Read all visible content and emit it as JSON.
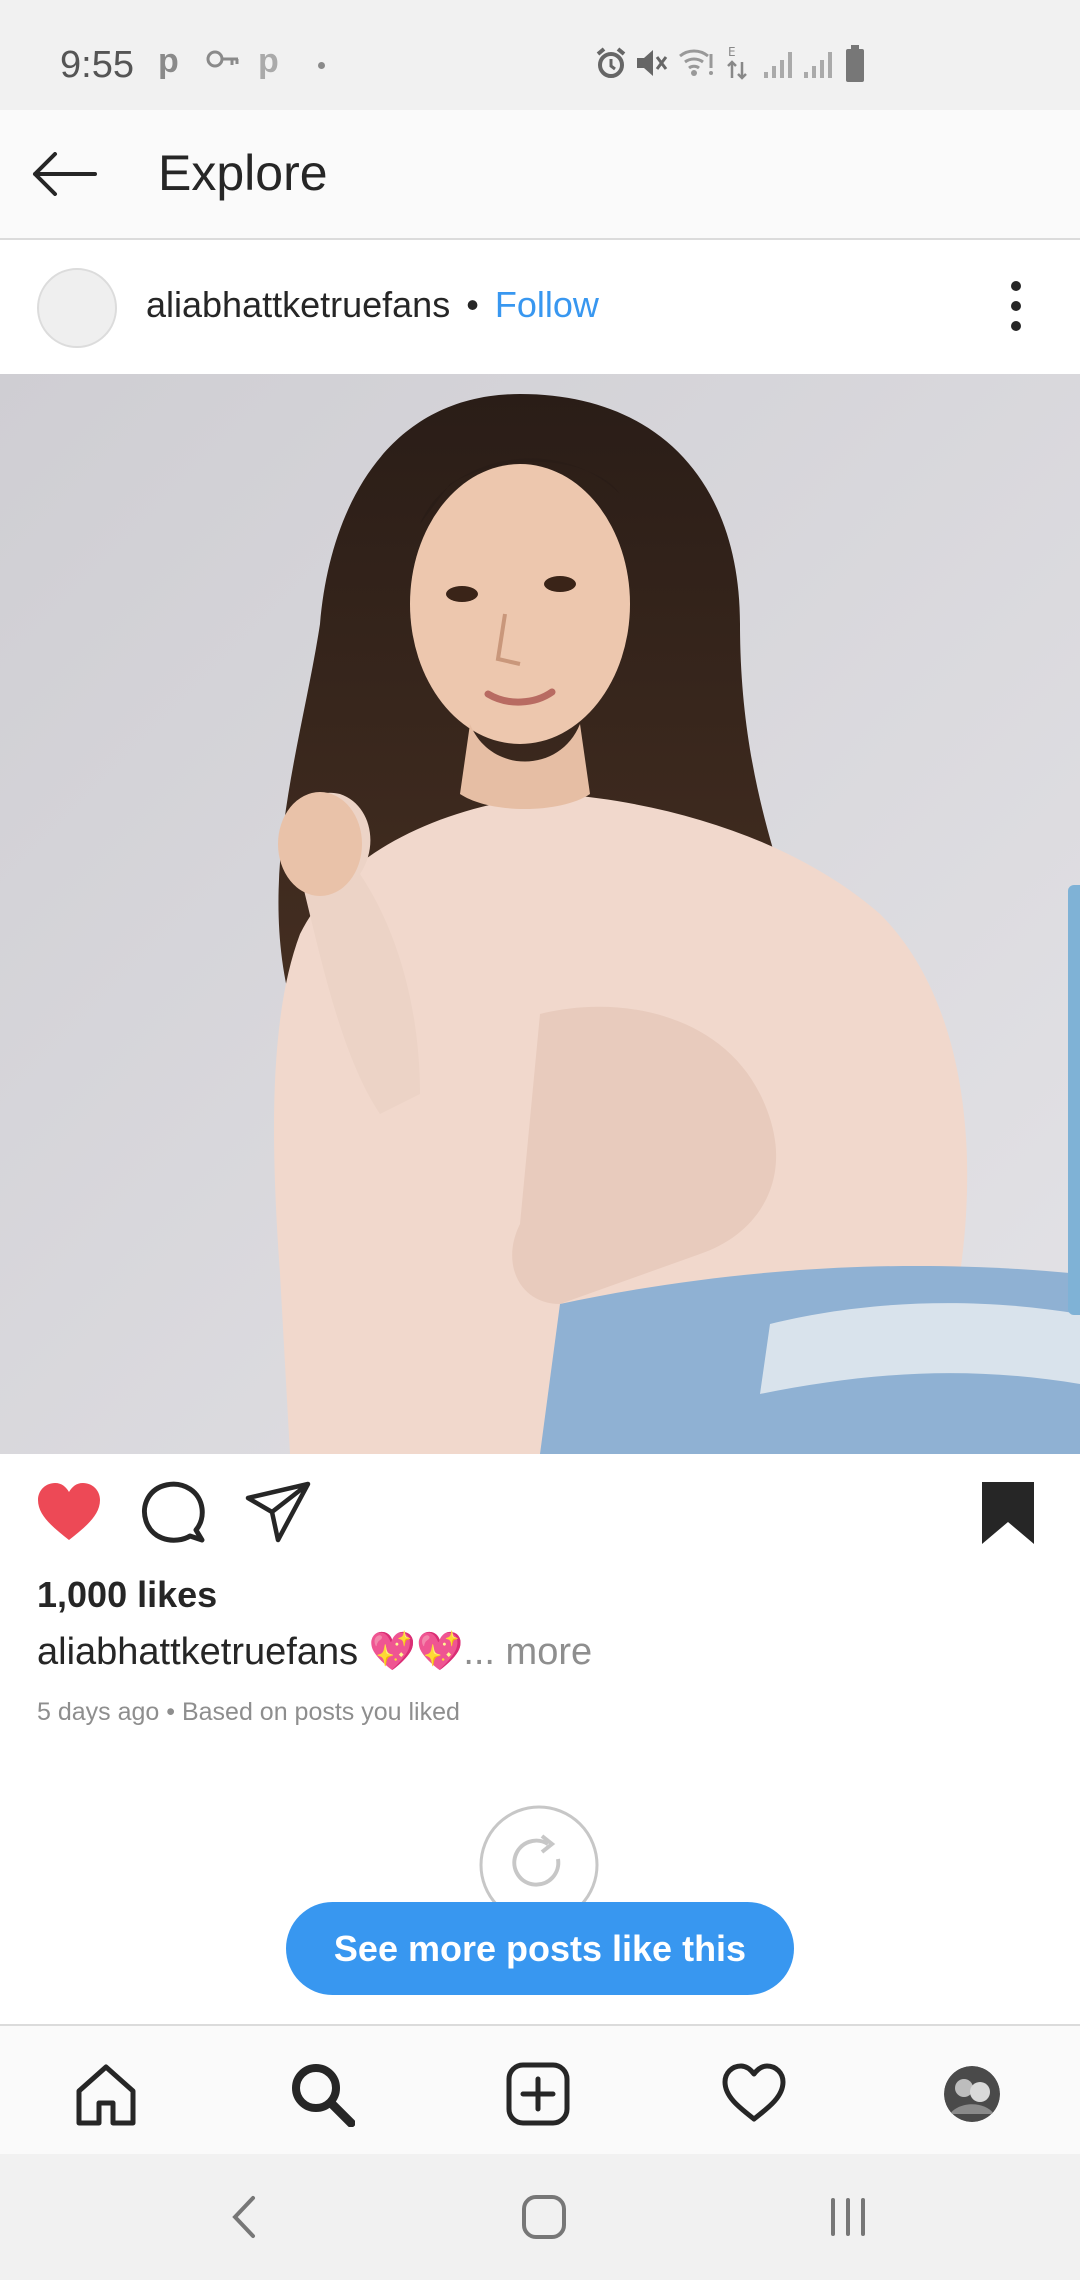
{
  "status_bar": {
    "time": "9:55",
    "notification_icons": [
      "pinterest-icon",
      "vpn-key-icon",
      "pinterest-icon",
      "dot"
    ],
    "system_icons": [
      "alarm-icon",
      "mute-icon",
      "wifi-icon",
      "data-e-icon",
      "signal-icon",
      "signal-icon",
      "battery-icon"
    ]
  },
  "header": {
    "title": "Explore",
    "back_icon": "arrow-left-icon"
  },
  "post": {
    "username": "aliabhattketruefans",
    "separator": "•",
    "follow_label": "Follow",
    "likes": "1,000 likes",
    "caption_user": "aliabhattketruefans",
    "caption_emoji": "💖💖",
    "caption_more": "... more",
    "meta": "5 days ago • Based on posts you liked",
    "liked": true,
    "saved": true
  },
  "cta": {
    "label": "See more posts like this"
  },
  "bottom_nav": {
    "items": [
      "home-icon",
      "search-icon",
      "add-post-icon",
      "activity-heart-icon",
      "profile-avatar"
    ],
    "active": "search-icon"
  },
  "colors": {
    "accent": "#3897f0",
    "like": "#ed4956",
    "text": "#262626",
    "muted": "#8e8e8e"
  }
}
